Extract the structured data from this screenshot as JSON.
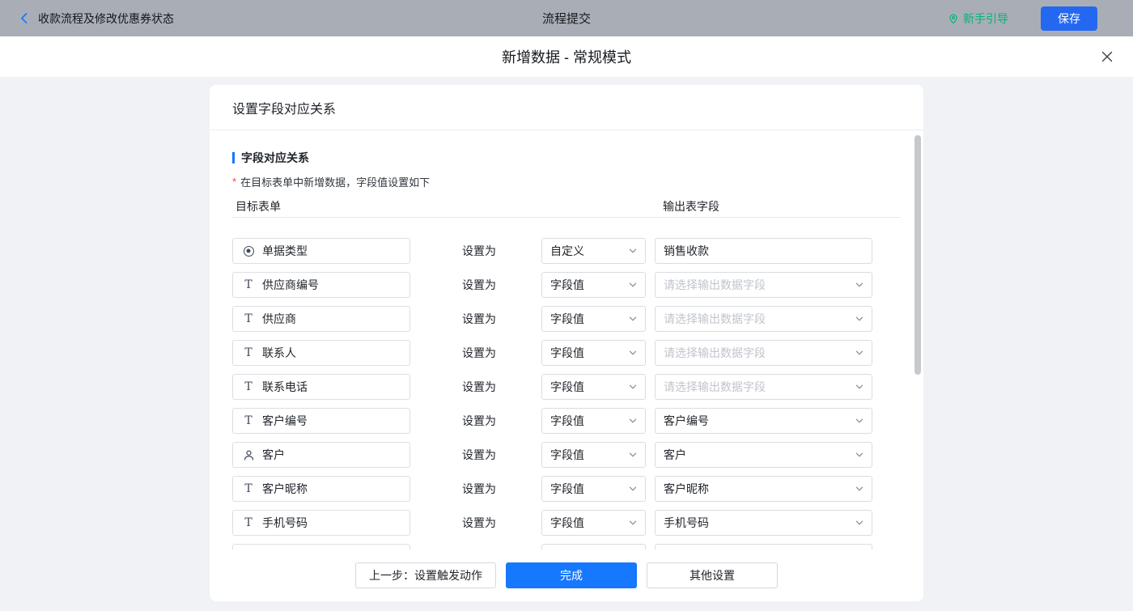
{
  "topbar": {
    "back_label": "收款流程及修改优惠券状态",
    "title": "流程提交",
    "guide_label": "新手引导",
    "save_label": "保存"
  },
  "modal": {
    "title": "新增数据 - 常规模式"
  },
  "card": {
    "header_title": "设置字段对应关系",
    "section_title": "字段对应关系",
    "required_mark": "*",
    "hint_text": "在目标表单中新增数据，字段值设置如下",
    "columns": {
      "target": "目标表单",
      "output": "输出表字段"
    },
    "set_as_label": "设置为",
    "rows": [
      {
        "icon": "radio",
        "field": "单据类型",
        "mode": "自定义",
        "output": "销售收款",
        "output_is_placeholder": false,
        "output_is_input": true
      },
      {
        "icon": "text",
        "field": "供应商编号",
        "mode": "字段值",
        "output": "请选择输出数据字段",
        "output_is_placeholder": true,
        "output_is_input": false
      },
      {
        "icon": "text",
        "field": "供应商",
        "mode": "字段值",
        "output": "请选择输出数据字段",
        "output_is_placeholder": true,
        "output_is_input": false
      },
      {
        "icon": "text",
        "field": "联系人",
        "mode": "字段值",
        "output": "请选择输出数据字段",
        "output_is_placeholder": true,
        "output_is_input": false
      },
      {
        "icon": "text",
        "field": "联系电话",
        "mode": "字段值",
        "output": "请选择输出数据字段",
        "output_is_placeholder": true,
        "output_is_input": false
      },
      {
        "icon": "text",
        "field": "客户编号",
        "mode": "字段值",
        "output": "客户编号",
        "output_is_placeholder": false,
        "output_is_input": false
      },
      {
        "icon": "user",
        "field": "客户",
        "mode": "字段值",
        "output": "客户",
        "output_is_placeholder": false,
        "output_is_input": false
      },
      {
        "icon": "text",
        "field": "客户昵称",
        "mode": "字段值",
        "output": "客户昵称",
        "output_is_placeholder": false,
        "output_is_input": false
      },
      {
        "icon": "text",
        "field": "手机号码",
        "mode": "字段值",
        "output": "手机号码",
        "output_is_placeholder": false,
        "output_is_input": false
      },
      {
        "icon": "",
        "field": "",
        "mode": "",
        "output": "",
        "output_is_placeholder": false,
        "output_is_input": false,
        "partial": true
      }
    ],
    "footer": {
      "prev_label": "上一步：设置触发动作",
      "done_label": "完成",
      "other_label": "其他设置"
    }
  },
  "colors": {
    "primary_blue": "#1677ff",
    "save_blue": "#2468f2",
    "guide_green": "#00b578",
    "required_red": "#f53f3f",
    "topbar_gray": "#a9aeb6"
  }
}
